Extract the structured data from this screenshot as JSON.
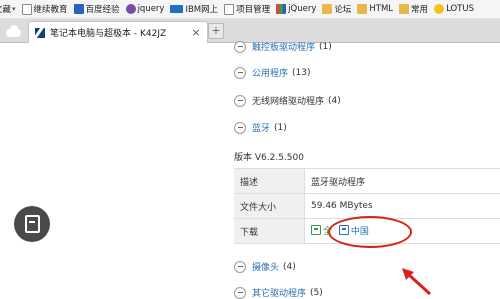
{
  "bookmarks": [
    {
      "label": "文藏",
      "icon": "folder-icon",
      "dropdown": true
    },
    {
      "label": "继续教育",
      "icon": "page-icon"
    },
    {
      "label": "百度经验",
      "icon": "baidu-icon"
    },
    {
      "label": "jquery",
      "icon": "purple-circle-icon"
    },
    {
      "label": "IBM网上",
      "icon": "ibm-icon"
    },
    {
      "label": "项目管理",
      "icon": "page-icon"
    },
    {
      "label": "jQuery",
      "icon": "multicolor-icon"
    },
    {
      "label": "论坛",
      "icon": "folder-icon"
    },
    {
      "label": "HTML",
      "icon": "folder-icon"
    },
    {
      "label": "常用",
      "icon": "folder-icon"
    },
    {
      "label": "LOTUS",
      "icon": "lotus-icon"
    }
  ],
  "tab": {
    "title": "笔记本电脑与超极本 - K42JZ",
    "close": "×"
  },
  "newtab": "+",
  "categories_top": [
    {
      "name": "触控板驱动程序",
      "count": "(1)"
    },
    {
      "name": "公用程序",
      "count": "(13)"
    },
    {
      "name": "无线网络驱动程序",
      "count": "(4)"
    },
    {
      "name": "蓝牙",
      "count": "(1)"
    }
  ],
  "version": "版本 V6.2.5.500",
  "detail": {
    "desc_label": "描述",
    "desc_value": "蓝牙驱动程序",
    "size_label": "文件大小",
    "size_value": "59.46 MBytes",
    "download_label": "下载",
    "download_global": "全",
    "download_china": "中国"
  },
  "categories_bottom": [
    {
      "name": "摄像头",
      "count": "(4)"
    },
    {
      "name": "其它驱动程序",
      "count": "(5)"
    }
  ],
  "colors": {
    "annotation": "#d9221b",
    "link": "#2b6fb6"
  }
}
